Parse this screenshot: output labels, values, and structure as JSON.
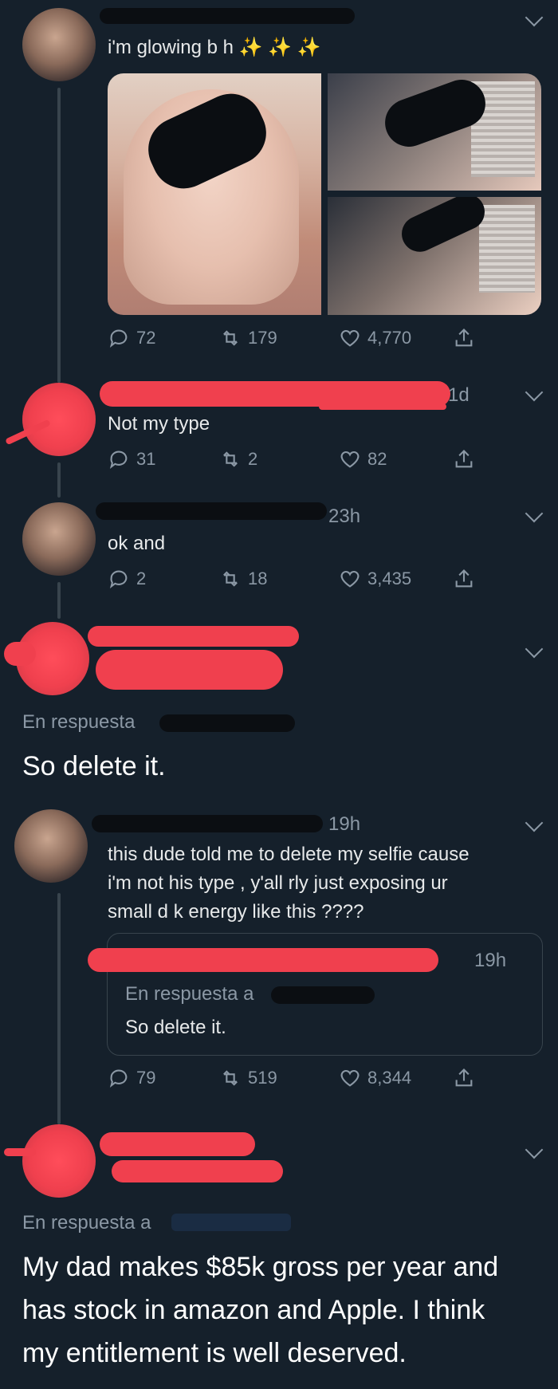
{
  "tweets": [
    {
      "text": "i'm glowing b h ✨ ✨ ✨",
      "actions": {
        "replies": "72",
        "retweets": "179",
        "likes": "4,770"
      }
    },
    {
      "time": "1d",
      "text": "Not my type",
      "actions": {
        "replies": "31",
        "retweets": "2",
        "likes": "82"
      }
    },
    {
      "time": "23h",
      "text": "ok and",
      "actions": {
        "replies": "2",
        "retweets": "18",
        "likes": "3,435"
      }
    },
    {
      "reply_label": "En respuesta",
      "text": "So delete it."
    },
    {
      "time": "19h",
      "text_lines": [
        "this dude told me to delete my selfie cause",
        "i'm not his type , y'all rly just exposing ur",
        "small d k energy like this ????"
      ],
      "quoted": {
        "time": "19h",
        "reply_label": "En respuesta a",
        "text": "So delete it."
      },
      "actions": {
        "replies": "79",
        "retweets": "519",
        "likes": "8,344"
      }
    },
    {
      "reply_label": "En respuesta a",
      "text_lines": [
        "My dad makes $85k gross per year and",
        "has stock in amazon and Apple. I think",
        "my entitlement is well deserved."
      ]
    }
  ]
}
